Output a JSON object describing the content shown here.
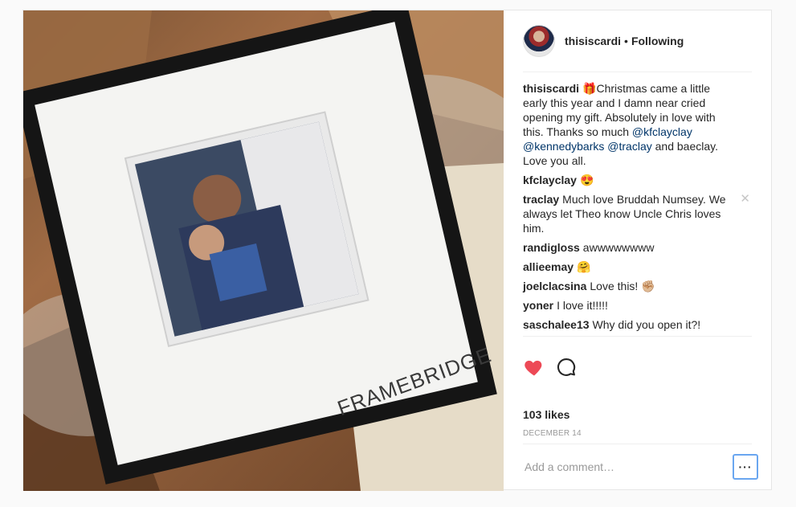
{
  "post": {
    "username": "thisiscardi",
    "separator": "•",
    "follow_status": "Following",
    "photo": {
      "bag_text": "FRAMEBRIDGE"
    },
    "caption": {
      "author": "thisiscardi",
      "emoji": "🎁",
      "text_1": "Christmas came a little early this year and I damn near cried opening my gift. Absolutely in love with this. Thanks so much ",
      "mention_1": "@kfclayclay",
      "mention_2": "@kennedybarks",
      "mention_3": "@traclay",
      "text_2": " and baeclay. Love you all."
    },
    "comments": [
      {
        "user": "kfclayclay",
        "text": "",
        "emoji": "😍"
      },
      {
        "user": "traclay",
        "text": "Much love Bruddah Numsey. We always let Theo know Uncle Chris loves him.",
        "emoji": "",
        "close": "✕"
      },
      {
        "user": "randigloss",
        "text": "awwwwwwww",
        "emoji": ""
      },
      {
        "user": "allieemay",
        "text": "",
        "emoji": "🤗"
      },
      {
        "user": "joelclacsina",
        "text": "Love this!",
        "emoji": "✊🏼"
      },
      {
        "user": "yoner",
        "text": "I love it!!!!!",
        "emoji": ""
      },
      {
        "user": "saschalee13",
        "text": "Why did you open it?!",
        "emoji": ""
      }
    ],
    "likes": "103 likes",
    "date": "DECEMBER 14",
    "add_comment_placeholder": "Add a comment…",
    "more_label": "···",
    "icons": {
      "like": "heart-icon",
      "comment": "comment-bubble-icon"
    },
    "colors": {
      "heart": "#ed4956",
      "mention": "#003569",
      "focus": "#6aa6f0"
    }
  }
}
